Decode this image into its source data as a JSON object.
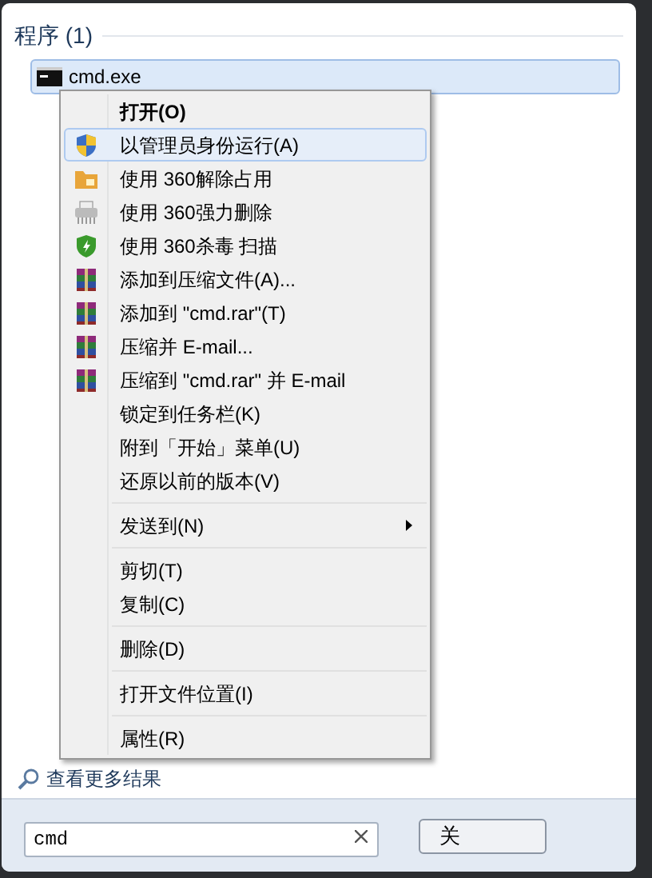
{
  "results": {
    "heading": "程序 (1)",
    "items": [
      {
        "label": "cmd.exe",
        "selected": true
      }
    ]
  },
  "context_menu": {
    "items": [
      {
        "kind": "plain",
        "label": "打开(O)",
        "default": true,
        "selected": false
      },
      {
        "kind": "shield",
        "label": "以管理员身份运行(A)",
        "selected": true
      },
      {
        "kind": "folder",
        "label": "使用 360解除占用",
        "selected": false
      },
      {
        "kind": "printer",
        "label": "使用 360强力删除",
        "selected": false
      },
      {
        "kind": "antivirus",
        "label": "使用 360杀毒 扫描",
        "selected": false
      },
      {
        "kind": "archive",
        "label": "添加到压缩文件(A)...",
        "selected": false
      },
      {
        "kind": "archive",
        "label": "添加到 \"cmd.rar\"(T)",
        "selected": false
      },
      {
        "kind": "archive",
        "label": "压缩并 E-mail...",
        "selected": false
      },
      {
        "kind": "archive",
        "label": "压缩到 \"cmd.rar\" 并 E-mail",
        "selected": false
      },
      {
        "kind": "plain",
        "label": "锁定到任务栏(K)",
        "selected": false
      },
      {
        "kind": "plain",
        "label": "附到「开始」菜单(U)",
        "selected": false
      },
      {
        "kind": "plain",
        "label": "还原以前的版本(V)",
        "selected": false
      },
      {
        "kind": "separator"
      },
      {
        "kind": "plain",
        "label": "发送到(N)",
        "submenu": true,
        "selected": false
      },
      {
        "kind": "separator"
      },
      {
        "kind": "plain",
        "label": "剪切(T)",
        "selected": false
      },
      {
        "kind": "plain",
        "label": "复制(C)",
        "selected": false
      },
      {
        "kind": "separator"
      },
      {
        "kind": "plain",
        "label": "删除(D)",
        "selected": false
      },
      {
        "kind": "separator"
      },
      {
        "kind": "plain",
        "label": "打开文件位置(I)",
        "selected": false
      },
      {
        "kind": "separator"
      },
      {
        "kind": "plain",
        "label": "属性(R)",
        "selected": false
      }
    ]
  },
  "more_results": {
    "label": "查看更多结果"
  },
  "search": {
    "value": "cmd"
  },
  "shutdown_button": {
    "label": "关"
  }
}
